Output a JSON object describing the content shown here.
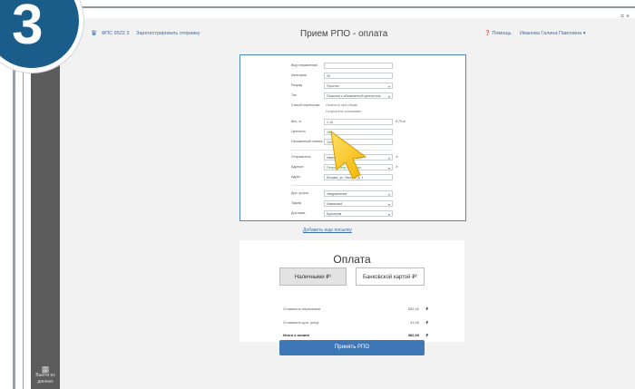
{
  "step_badge": "3",
  "sidebar": {
    "bottom_button": "Выйти из данных"
  },
  "window": {
    "controls": "=  ×"
  },
  "header": {
    "logo_text": "ФПС 9522  3",
    "link_text": "Зарегистрировать отправку",
    "title": "Прием РПО - оплата",
    "help": "Помощь",
    "user": "Иванова Галина Павловна"
  },
  "form": {
    "rows": [
      {
        "label": "Вид отправления",
        "value": ""
      },
      {
        "label": "Категория",
        "value": "39"
      },
      {
        "label": "Разряд",
        "value": "Простое"
      },
      {
        "label": "Тип",
        "value": "Посылка с объявленной ценностью"
      },
      {
        "label": "Способ пересылки",
        "value": ""
      },
      {
        "label": "Вес, кг",
        "value": "1,15",
        "side": "0,75 кг"
      },
      {
        "label": "Ценность",
        "value": "100"
      },
      {
        "label": "Наложенный платеж",
        "value": "100"
      },
      {
        "label": "Отправитель",
        "value": "Иванов Иван Иванович"
      },
      {
        "label": "Адресат",
        "value": "Петров Петр Петрович"
      },
      {
        "label": "Адрес",
        "value": "Москва, ул. Ленина, д. 1"
      },
      {
        "label": "Доп. услуги",
        "value": "Уведомление"
      },
      {
        "label": "Тариф",
        "value": "Наземный"
      },
      {
        "label": "Доставка",
        "value": "Курьером"
      }
    ],
    "notes": [
      "Отметить при сборке",
      "Получатель оплачивает"
    ]
  },
  "add_link": "Добавить еще посылку",
  "payment": {
    "title": "Оплата",
    "cash_tab": "Наличными ₽¹",
    "card_tab": "Банковской картой ₽²",
    "currency": "₽",
    "rows": [
      {
        "label": "Стоимость пересылки",
        "value": "351,00"
      },
      {
        "label": "Стоимость доп. услуг",
        "value": "31,00"
      },
      {
        "label": "Итого к оплате",
        "value": "382,00"
      }
    ],
    "accept_button": "Принять РПО"
  }
}
